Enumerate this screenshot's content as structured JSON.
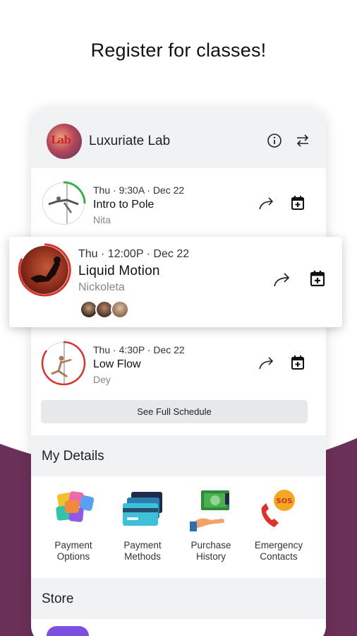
{
  "headline": "Register for classes!",
  "studio": {
    "name": "Luxuriate Lab",
    "logo_text": "Lab"
  },
  "header_icons": [
    "info-icon",
    "swap-icon"
  ],
  "classes": [
    {
      "when": "Thu · 9:30A · Dec 22",
      "title": "Intro to Pole",
      "instructor": "Nita"
    },
    {
      "when": "Thu · 12:00P · Dec 22",
      "title": "Liquid Motion",
      "instructor": "Nickoleta",
      "attendee_count": 3
    },
    {
      "when": "Thu · 4:30P · Dec 22",
      "title": "Low Flow",
      "instructor": "Dey"
    }
  ],
  "see_full_schedule": "See Full Schedule",
  "my_details": {
    "title": "My Details",
    "tiles": [
      {
        "label": "Payment Options",
        "icon": "payment-options-icon"
      },
      {
        "label": "Payment Methods",
        "icon": "credit-cards-icon"
      },
      {
        "label": "Purchase History",
        "icon": "cash-hand-icon"
      },
      {
        "label": "Emergency Contacts",
        "icon": "sos-phone-icon"
      }
    ]
  },
  "store": {
    "title": "Store"
  },
  "colors": {
    "accent_red": "#d8322c",
    "accent_green": "#3cb043",
    "wave": "#6b3058",
    "section_bg": "#f1f2f4"
  }
}
